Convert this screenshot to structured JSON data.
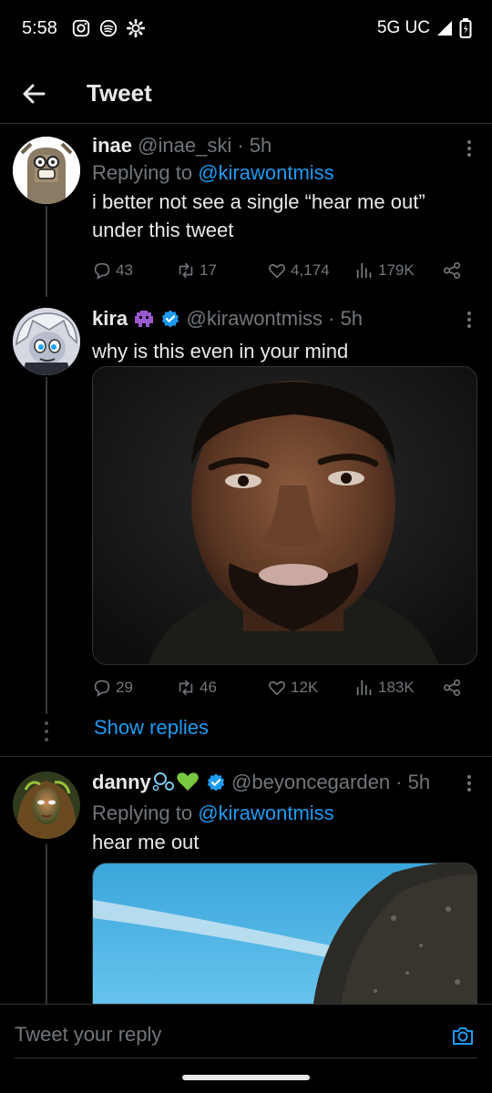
{
  "status_bar": {
    "time": "5:58",
    "network": "5G UC",
    "icons": [
      "instagram-icon",
      "spotify-icon",
      "settings-gear-icon",
      "signal-icon",
      "battery-icon"
    ]
  },
  "header": {
    "title": "Tweet",
    "back_icon": "arrow-left-icon"
  },
  "tweets": [
    {
      "name": "inae",
      "handle": "@inae_ski",
      "time": "5h",
      "replying_label": "Replying to",
      "replying_to": "@kirawontmiss",
      "text": "i better not see a single “hear me out” under this tweet",
      "replies": "43",
      "retweets": "17",
      "likes": "4,174",
      "views": "179K"
    },
    {
      "name": "kira",
      "emoji": "👾",
      "verified": true,
      "handle": "@kirawontmiss",
      "time": "5h",
      "text": "why is this even in your mind",
      "replies": "29",
      "retweets": "46",
      "likes": "12K",
      "views": "183K",
      "show_replies": "Show replies"
    },
    {
      "name": "danny",
      "emoji": "🫧💚",
      "verified": true,
      "handle": "@beyoncegarden",
      "time": "5h",
      "replying_label": "Replying to",
      "replying_to": "@kirawontmiss",
      "text": "hear me out"
    }
  ],
  "reply_bar": {
    "placeholder": "Tweet your reply",
    "camera_icon": "camera-icon"
  },
  "colors": {
    "background": "#000000",
    "accent": "#1d9bf0",
    "muted": "#71767b",
    "text": "#e7e9ea"
  }
}
